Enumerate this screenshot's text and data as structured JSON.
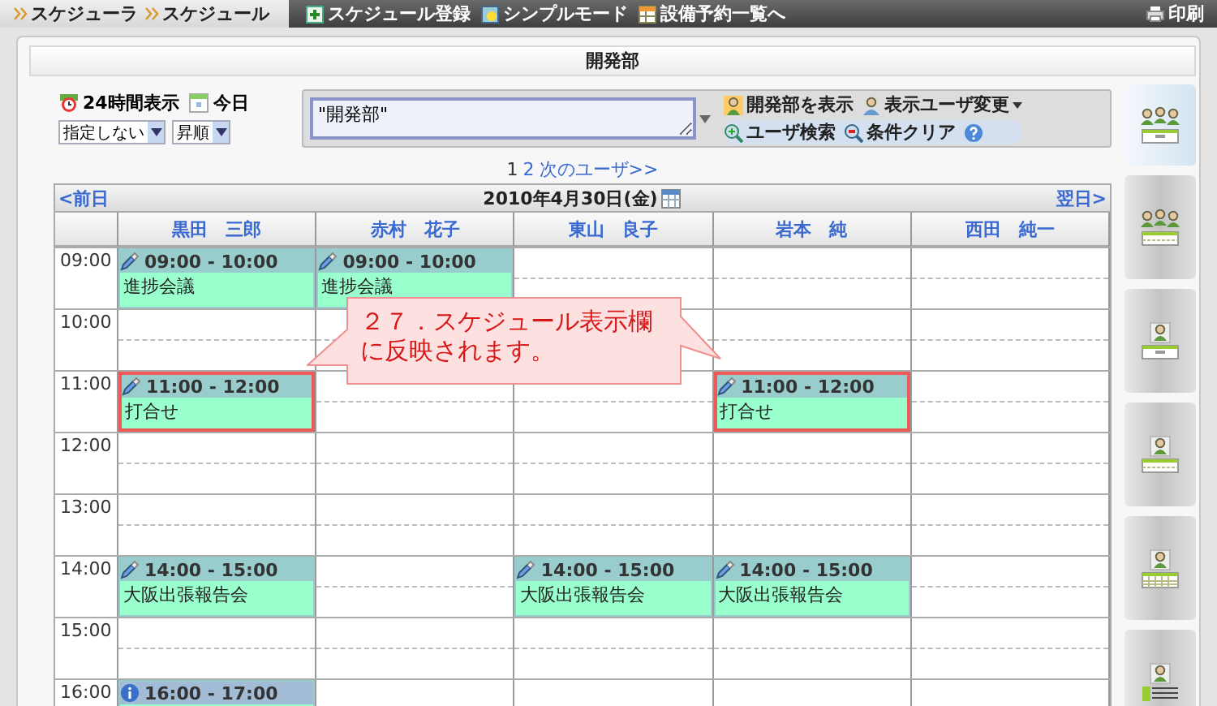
{
  "topbar": {
    "breadcrumb": [
      "スケジューラ",
      "スケジュール"
    ],
    "links": [
      {
        "label": "スケジュール登録",
        "kind": "add"
      },
      {
        "label": "シンプルモード",
        "kind": "simple"
      },
      {
        "label": "設備予約一覧へ",
        "kind": "facility"
      }
    ],
    "print": "印刷"
  },
  "panel_title": "開発部",
  "controls": {
    "toggles": [
      {
        "label": "24時間表示",
        "kind": "clock"
      },
      {
        "label": "今日",
        "kind": "calendar"
      }
    ],
    "selects": [
      {
        "value": "指定しない"
      },
      {
        "value": "昇順"
      }
    ],
    "group_field": {
      "value": "\"開発部\""
    },
    "buttons": [
      {
        "label": "開発部を表示",
        "kind": "group",
        "dropdown": false
      },
      {
        "label": "表示ユーザ変更",
        "kind": "user",
        "dropdown": true
      },
      {
        "label": "ユーザ検索",
        "kind": "search",
        "dropdown": false
      },
      {
        "label": "条件クリア",
        "kind": "clear",
        "dropdown": false
      }
    ]
  },
  "pagination": {
    "pages": [
      {
        "label": "1",
        "selected": true
      },
      {
        "label": "2",
        "selected": false
      }
    ],
    "next": "次のユーザ>>"
  },
  "calendar": {
    "prev": "<前日",
    "date": "2010年4月30日(金)",
    "next": "翌日>",
    "users": [
      "黒田　三郎",
      "赤村　花子",
      "東山　良子",
      "岩本　純",
      "西田　純一"
    ],
    "rows": [
      {
        "time": "09:00",
        "cells": [
          {
            "kind": "event",
            "time": "09:00 - 10:00",
            "title": "進捗会議",
            "highlighted": false,
            "color": "#99cccc"
          },
          {
            "kind": "event",
            "time": "09:00 - 10:00",
            "title": "進捗会議",
            "highlighted": false,
            "color": "#99cccc"
          },
          {
            "kind": "empty"
          },
          {
            "kind": "empty"
          },
          {
            "kind": "empty"
          }
        ]
      },
      {
        "time": "10:00",
        "cells": [
          {
            "kind": "empty"
          },
          {
            "kind": "empty"
          },
          {
            "kind": "empty"
          },
          {
            "kind": "empty"
          },
          {
            "kind": "empty"
          }
        ]
      },
      {
        "time": "11:00",
        "cells": [
          {
            "kind": "event",
            "time": "11:00 - 12:00",
            "title": "打合せ",
            "highlighted": true,
            "color": "#99cccc"
          },
          {
            "kind": "empty"
          },
          {
            "kind": "empty"
          },
          {
            "kind": "event",
            "time": "11:00 - 12:00",
            "title": "打合せ",
            "highlighted": true,
            "color": "#99cccc"
          },
          {
            "kind": "empty"
          }
        ]
      },
      {
        "time": "12:00",
        "cells": [
          {
            "kind": "empty"
          },
          {
            "kind": "empty"
          },
          {
            "kind": "empty"
          },
          {
            "kind": "empty"
          },
          {
            "kind": "empty"
          }
        ]
      },
      {
        "time": "13:00",
        "cells": [
          {
            "kind": "empty"
          },
          {
            "kind": "empty"
          },
          {
            "kind": "empty"
          },
          {
            "kind": "empty"
          },
          {
            "kind": "empty"
          }
        ]
      },
      {
        "time": "14:00",
        "cells": [
          {
            "kind": "event",
            "time": "14:00 - 15:00",
            "title": "大阪出張報告会",
            "highlighted": false,
            "color": "#99cccc"
          },
          {
            "kind": "empty"
          },
          {
            "kind": "event",
            "time": "14:00 - 15:00",
            "title": "大阪出張報告会",
            "highlighted": false,
            "color": "#99cccc"
          },
          {
            "kind": "event",
            "time": "14:00 - 15:00",
            "title": "大阪出張報告会",
            "highlighted": false,
            "color": "#99cccc"
          },
          {
            "kind": "empty"
          }
        ]
      },
      {
        "time": "15:00",
        "cells": [
          {
            "kind": "empty"
          },
          {
            "kind": "empty"
          },
          {
            "kind": "empty"
          },
          {
            "kind": "empty"
          },
          {
            "kind": "empty"
          }
        ]
      },
      {
        "time": "16:00",
        "cells": [
          {
            "kind": "info-event",
            "time": "16:00 - 17:00",
            "highlighted": false,
            "color": "#a3bcd6"
          },
          {
            "kind": "empty"
          },
          {
            "kind": "empty"
          },
          {
            "kind": "empty"
          },
          {
            "kind": "empty"
          }
        ]
      }
    ]
  },
  "callout": {
    "lines": [
      "２７．スケジュール表示欄",
      "に反映されます。"
    ]
  },
  "views": [
    {
      "kind": "group-day",
      "selected": true
    },
    {
      "kind": "group-week",
      "selected": false
    },
    {
      "kind": "person-day",
      "selected": false
    },
    {
      "kind": "person-week",
      "selected": false
    },
    {
      "kind": "person-month",
      "selected": false
    },
    {
      "kind": "person-list",
      "selected": false
    }
  ]
}
